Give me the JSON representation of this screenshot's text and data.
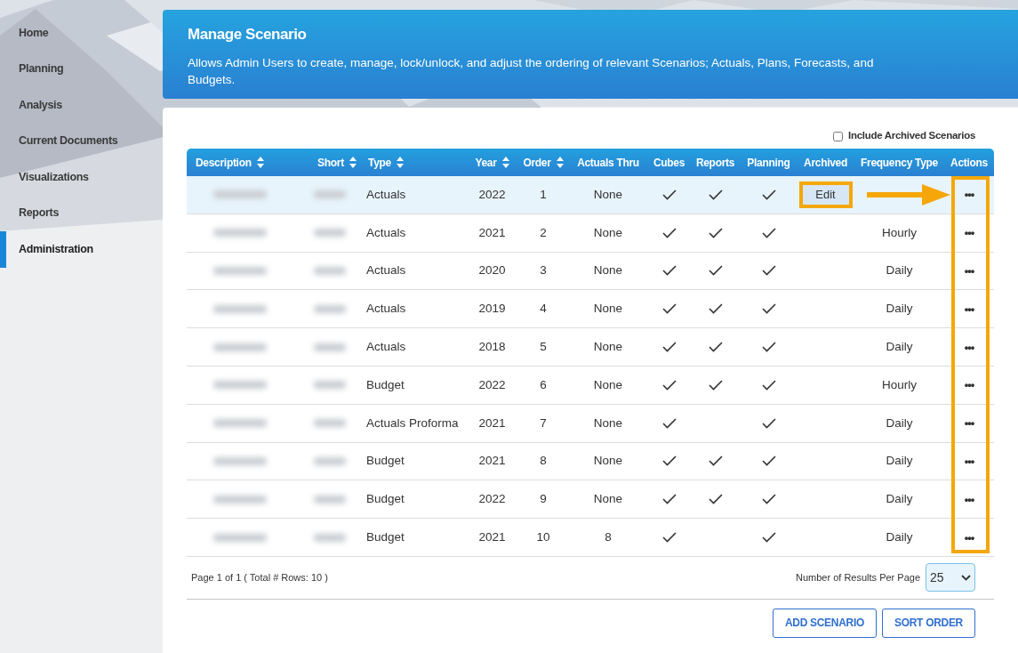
{
  "sidebar": {
    "items": [
      {
        "label": "Home",
        "selected": false
      },
      {
        "label": "Planning",
        "selected": false
      },
      {
        "label": "Analysis",
        "selected": false
      },
      {
        "label": "Current Documents",
        "selected": false
      },
      {
        "label": "Visualizations",
        "selected": false
      },
      {
        "label": "Reports",
        "selected": false
      },
      {
        "label": "Administration",
        "selected": true
      }
    ]
  },
  "header": {
    "title": "Manage Scenario",
    "description": "Allows Admin Users to create, manage, lock/unlock, and adjust the ordering of relevant Scenarios; Actuals, Plans, Forecasts, and Budgets."
  },
  "include_archived": {
    "label": "Include Archived Scenarios",
    "checked": false
  },
  "table": {
    "columns": [
      {
        "label": "Description",
        "sortable": true
      },
      {
        "label": "Short",
        "sortable": true
      },
      {
        "label": "Type",
        "sortable": true
      },
      {
        "label": "Year",
        "sortable": true
      },
      {
        "label": "Order",
        "sortable": true
      },
      {
        "label": "Actuals Thru",
        "sortable": false
      },
      {
        "label": "Cubes",
        "sortable": false
      },
      {
        "label": "Reports",
        "sortable": false
      },
      {
        "label": "Planning",
        "sortable": false
      },
      {
        "label": "Archived",
        "sortable": false
      },
      {
        "label": "Frequency Type",
        "sortable": false
      },
      {
        "label": "Actions",
        "sortable": false
      }
    ],
    "rows": [
      {
        "selected": true,
        "type": "Actuals",
        "year": "2022",
        "order": "1",
        "actuals_thru": "None",
        "cubes": true,
        "reports": true,
        "planning": true,
        "edit_button": "Edit",
        "actions": "•••"
      },
      {
        "selected": false,
        "type": "Actuals",
        "year": "2021",
        "order": "2",
        "actuals_thru": "None",
        "cubes": true,
        "reports": true,
        "planning": true,
        "frequency": "Hourly",
        "actions": "•••"
      },
      {
        "selected": false,
        "type": "Actuals",
        "year": "2020",
        "order": "3",
        "actuals_thru": "None",
        "cubes": true,
        "reports": true,
        "planning": true,
        "frequency": "Daily",
        "actions": "•••"
      },
      {
        "selected": false,
        "type": "Actuals",
        "year": "2019",
        "order": "4",
        "actuals_thru": "None",
        "cubes": true,
        "reports": true,
        "planning": true,
        "frequency": "Daily",
        "actions": "•••"
      },
      {
        "selected": false,
        "type": "Actuals",
        "year": "2018",
        "order": "5",
        "actuals_thru": "None",
        "cubes": true,
        "reports": true,
        "planning": true,
        "frequency": "Daily",
        "actions": "•••"
      },
      {
        "selected": false,
        "type": "Budget",
        "year": "2022",
        "order": "6",
        "actuals_thru": "None",
        "cubes": true,
        "reports": true,
        "planning": true,
        "frequency": "Hourly",
        "actions": "•••"
      },
      {
        "selected": false,
        "type": "Actuals Proforma",
        "year": "2021",
        "order": "7",
        "actuals_thru": "None",
        "cubes": true,
        "reports": false,
        "planning": true,
        "frequency": "Daily",
        "actions": "•••"
      },
      {
        "selected": false,
        "type": "Budget",
        "year": "2021",
        "order": "8",
        "actuals_thru": "None",
        "cubes": true,
        "reports": true,
        "planning": true,
        "frequency": "Daily",
        "actions": "•••"
      },
      {
        "selected": false,
        "type": "Budget",
        "year": "2022",
        "order": "9",
        "actuals_thru": "None",
        "cubes": true,
        "reports": true,
        "planning": true,
        "frequency": "Daily",
        "actions": "•••"
      },
      {
        "selected": false,
        "type": "Budget",
        "year": "2021",
        "order": "10",
        "actuals_thru": "8",
        "cubes": true,
        "reports": false,
        "planning": true,
        "frequency": "Daily",
        "actions": "•••"
      }
    ]
  },
  "footer": {
    "page_info": "Page 1 of 1 ( Total # Rows: 10 )",
    "per_page_label": "Number of Results Per Page",
    "per_page_value": "25"
  },
  "buttons": [
    "ADD SCENARIO",
    "SORT ORDER"
  ]
}
